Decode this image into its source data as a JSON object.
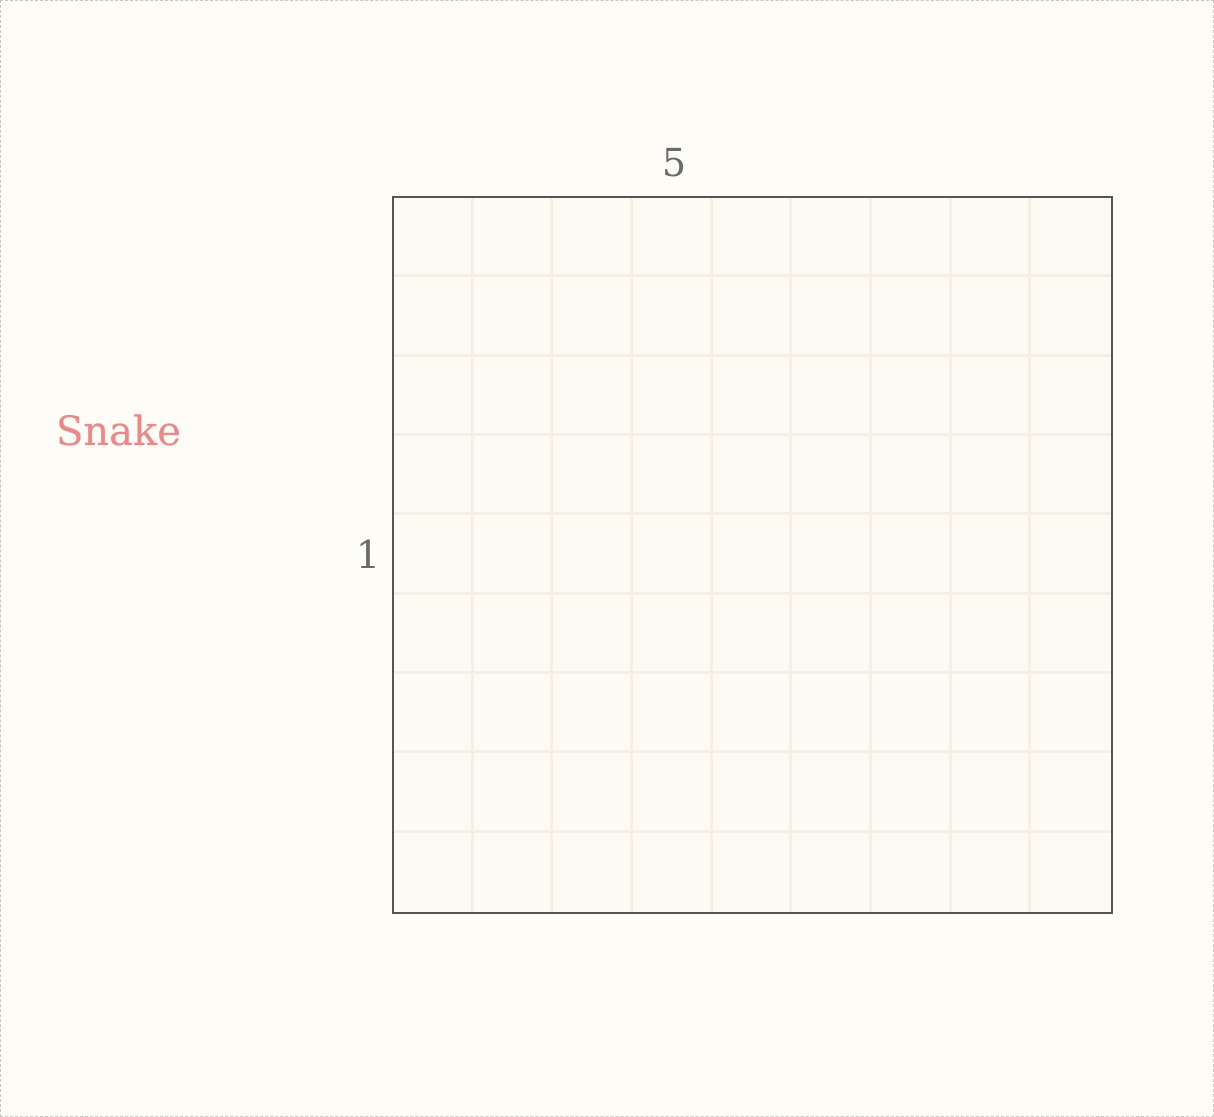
{
  "game": {
    "title": "Snake",
    "top_number": "5",
    "side_number": "1",
    "grid": {
      "rows": 9,
      "cols": 9
    }
  },
  "colors": {
    "background": "#fdfcf7",
    "title": "#e58b8b",
    "board_border": "#555555",
    "grid_line": "#f5efe6",
    "numbers": "#6a6a6a"
  }
}
